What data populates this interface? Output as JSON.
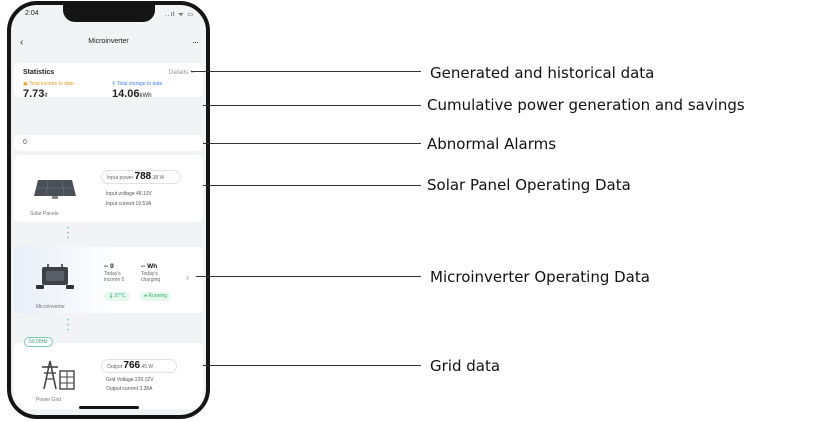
{
  "status_bar": {
    "time": "2:04",
    "icons": "..ıl ᯤ ▭"
  },
  "nav": {
    "back_icon": "‹",
    "title": "Microinverter",
    "more_icon": "···"
  },
  "statistics": {
    "title": "Statistics",
    "details": "Details >",
    "label_left": "Total income to date",
    "value_left": "7.73",
    "unit_left": "¢",
    "label_right": "Total storage to date",
    "value_right": "14.06",
    "unit_right": "kWh"
  },
  "alarm": {
    "count": "0"
  },
  "solar": {
    "power_label": "Input power",
    "power_value": "788",
    "power_unit": ".38 W",
    "line1": "Input voltage 48.13V",
    "line2": "Input current 19.53A",
    "device_label": "Solar Panels"
  },
  "micro": {
    "col1_value": "-- 0",
    "col1_line1": "Today's",
    "col1_line2": "income 0",
    "col2_value": "-- Wh",
    "col2_line1": "Today's",
    "col2_line2": "charging",
    "temp": "37°C",
    "status": "Running",
    "device_label": "Microinverter"
  },
  "grid": {
    "tag": "50.00Hz",
    "power_label": "Output",
    "power_value": "766",
    "power_unit": ".45 W",
    "line1": "Grid Voltage 226.12V",
    "line2": "Output current 3.38A",
    "device_label": "Power Grid"
  },
  "annotations": [
    "Generated and historical data",
    "Cumulative power generation and savings",
    "Abnormal Alarms",
    "Solar Panel Operating Data",
    "Microinverter Operating Data",
    "Grid data"
  ],
  "colors": {
    "accent_orange": "#e59a1f",
    "accent_blue": "#3f7ee8",
    "running_green": "#38b07a",
    "phone_frame": "#151515"
  }
}
